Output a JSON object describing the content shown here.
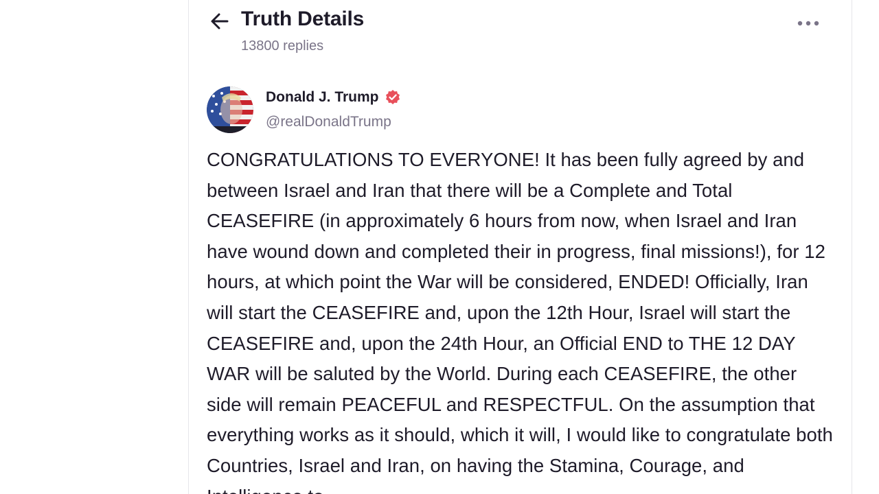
{
  "header": {
    "title": "Truth Details",
    "replies_text": "13800 replies",
    "back_icon": "arrow-left-icon",
    "more_icon": "ellipsis-horizontal-icon"
  },
  "post": {
    "author_name": "Donald J. Trump",
    "author_handle": "@realDonaldTrump",
    "verified_badge_color": "#e8505b",
    "body_text": "CONGRATULATIONS TO EVERYONE! It has been fully agreed by and between Israel and Iran that there will be a Complete and Total CEASEFIRE (in approximately 6 hours from now, when Israel and Iran have wound down and completed their in progress, final missions!), for 12 hours, at which point the War will be considered, ENDED! Officially, Iran will start the CEASEFIRE and, upon the 12th Hour, Israel will start the CEASEFIRE and, upon the 24th Hour, an Official END to THE 12 DAY WAR will be saluted by the World. During each CEASEFIRE, the other side will remain PEACEFUL and RESPECTFUL. On the assumption that everything works as it should, which it will, I would like to congratulate both Countries, Israel and Iran, on having the Stamina, Courage, and Intelligence to"
  },
  "colors": {
    "text_primary": "#1e1b29",
    "text_secondary": "#7a7488",
    "divider": "#e6e6ea"
  }
}
